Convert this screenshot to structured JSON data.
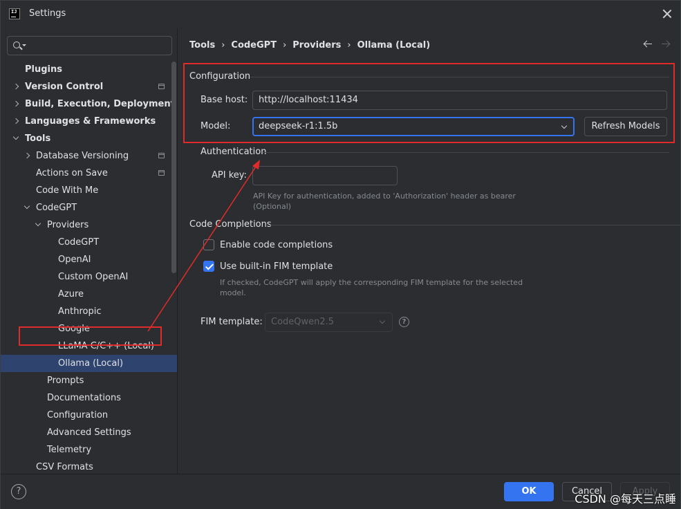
{
  "window": {
    "title": "Settings"
  },
  "search": {
    "placeholder": ""
  },
  "sidebar": {
    "items": [
      {
        "label": "Plugins",
        "level": 0,
        "bold": true,
        "chevron": "",
        "proj": false
      },
      {
        "label": "Version Control",
        "level": 0,
        "bold": true,
        "chevron": "right",
        "proj": true
      },
      {
        "label": "Build, Execution, Deployment",
        "level": 0,
        "bold": true,
        "chevron": "right",
        "proj": false
      },
      {
        "label": "Languages & Frameworks",
        "level": 0,
        "bold": true,
        "chevron": "right",
        "proj": false
      },
      {
        "label": "Tools",
        "level": 0,
        "bold": true,
        "chevron": "down",
        "proj": false
      },
      {
        "label": "Database Versioning",
        "level": 1,
        "bold": false,
        "chevron": "right",
        "proj": true
      },
      {
        "label": "Actions on Save",
        "level": 1,
        "bold": false,
        "chevron": "",
        "proj": true
      },
      {
        "label": "Code With Me",
        "level": 1,
        "bold": false,
        "chevron": "",
        "proj": false
      },
      {
        "label": "CodeGPT",
        "level": 1,
        "bold": false,
        "chevron": "down",
        "proj": false
      },
      {
        "label": "Providers",
        "level": 2,
        "bold": false,
        "chevron": "down",
        "proj": false
      },
      {
        "label": "CodeGPT",
        "level": 3,
        "bold": false,
        "chevron": "",
        "proj": false
      },
      {
        "label": "OpenAI",
        "level": 3,
        "bold": false,
        "chevron": "",
        "proj": false
      },
      {
        "label": "Custom OpenAI",
        "level": 3,
        "bold": false,
        "chevron": "",
        "proj": false
      },
      {
        "label": "Azure",
        "level": 3,
        "bold": false,
        "chevron": "",
        "proj": false
      },
      {
        "label": "Anthropic",
        "level": 3,
        "bold": false,
        "chevron": "",
        "proj": false
      },
      {
        "label": "Google",
        "level": 3,
        "bold": false,
        "chevron": "",
        "proj": false
      },
      {
        "label": "LLaMA C/C++ (Local)",
        "level": 3,
        "bold": false,
        "chevron": "",
        "proj": false
      },
      {
        "label": "Ollama (Local)",
        "level": 3,
        "bold": false,
        "chevron": "",
        "proj": false,
        "selected": true
      },
      {
        "label": "Prompts",
        "level": 2,
        "bold": false,
        "chevron": "",
        "proj": false
      },
      {
        "label": "Documentations",
        "level": 2,
        "bold": false,
        "chevron": "",
        "proj": false
      },
      {
        "label": "Configuration",
        "level": 2,
        "bold": false,
        "chevron": "",
        "proj": false
      },
      {
        "label": "Advanced Settings",
        "level": 2,
        "bold": false,
        "chevron": "",
        "proj": false
      },
      {
        "label": "Telemetry",
        "level": 2,
        "bold": false,
        "chevron": "",
        "proj": false
      },
      {
        "label": "CSV Formats",
        "level": 1,
        "bold": false,
        "chevron": "",
        "proj": false
      }
    ]
  },
  "breadcrumb": {
    "items": [
      "Tools",
      "CodeGPT",
      "Providers",
      "Ollama (Local)"
    ],
    "separator": "›"
  },
  "configuration": {
    "title": "Configuration",
    "base_host_label": "Base host:",
    "base_host_value": "http://localhost:11434",
    "model_label": "Model:",
    "model_value": "deepseek-r1:1.5b",
    "refresh_label": "Refresh Models"
  },
  "authentication": {
    "title": "Authentication",
    "api_key_label": "API key:",
    "api_key_value": "",
    "help_line1": "API Key for authentication, added to 'Authorization' header as bearer",
    "help_line2": "(Optional)"
  },
  "code_completions": {
    "title": "Code Completions",
    "enable_label": "Enable code completions",
    "enable_checked": false,
    "fim_builtin_label": "Use built-in FIM template",
    "fim_builtin_checked": true,
    "fim_help_line1": "If checked, CodeGPT will apply the corresponding FIM template for the selected",
    "fim_help_line2": "model.",
    "fim_template_label": "FIM template:",
    "fim_template_value": "CodeQwen2.5"
  },
  "footer": {
    "help": "?",
    "ok": "OK",
    "cancel": "Cancel",
    "apply": "Apply"
  },
  "watermark": "CSDN @每天三点睡",
  "colors": {
    "accent": "#3574f0",
    "annotation": "#e02b2b",
    "selection": "#2e436e"
  }
}
